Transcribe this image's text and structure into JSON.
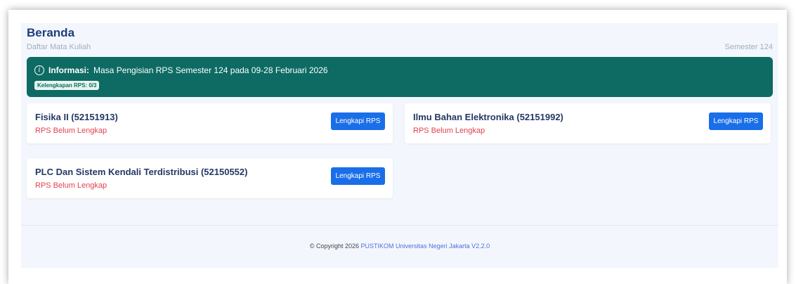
{
  "header": {
    "title": "Beranda",
    "subtitle": "Daftar Mata Kuliah",
    "semester": "Semester 124"
  },
  "info": {
    "label": "Informasi:",
    "message": "Masa Pengisian RPS Semester 124 pada 09-28 Februari 2026",
    "badge": "Kelengkapan RPS: 0/3"
  },
  "courses": [
    {
      "title": "Fisika II (52151913)",
      "status": "RPS Belum Lengkap",
      "button": "Lengkapi RPS"
    },
    {
      "title": "Ilmu Bahan Elektronika (52151992)",
      "status": "RPS Belum Lengkap",
      "button": "Lengkapi RPS"
    },
    {
      "title": "PLC Dan Sistem Kendali Terdistribusi (52150552)",
      "status": "RPS Belum Lengkap",
      "button": "Lengkapi RPS"
    }
  ],
  "footer": {
    "copyright": "© Copyright 2026",
    "link": "PUSTIKOM Universitas Negeri Jakarta V2.2.0"
  },
  "colors": {
    "info_bg": "#0d6b63",
    "button": "#1a6fe8",
    "status": "#e0414f",
    "title": "#1f3d7a"
  }
}
